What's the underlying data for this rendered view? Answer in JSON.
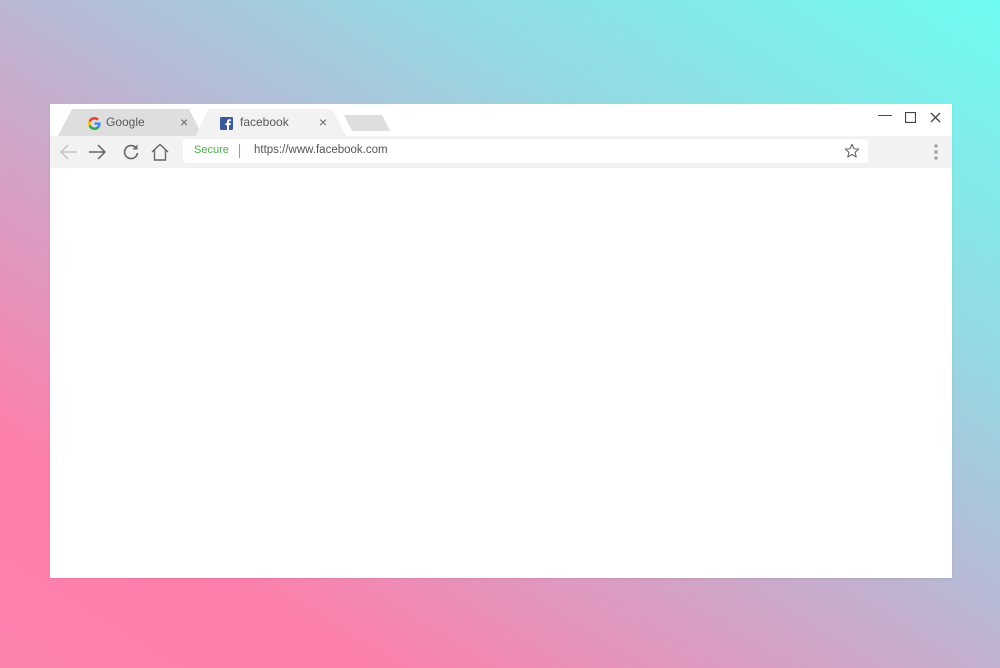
{
  "tabs": [
    {
      "title": "Google",
      "favicon": "google-g-icon",
      "active": false,
      "close_label": "×"
    },
    {
      "title": "facebook",
      "favicon": "facebook-f-icon",
      "active": true,
      "close_label": "×"
    }
  ],
  "window_controls": {
    "minimize": "—",
    "maximize": "☐",
    "close": "✕"
  },
  "toolbar": {
    "back_icon": "arrow-left-icon",
    "forward_icon": "arrow-right-icon",
    "reload_icon": "reload-icon",
    "home_icon": "home-icon",
    "menu_icon": "kebab-menu-icon",
    "bookmark_icon": "star-icon"
  },
  "omnibox": {
    "security_label": "Secure",
    "url": "https://www.facebook.com"
  },
  "colors": {
    "secure_green": "#4caf50",
    "facebook_blue": "#3b5998",
    "inactive_tab": "#dedede",
    "toolbar": "#f2f2f2",
    "gradient_start": "#6ffcf2",
    "gradient_end": "#fd82ac"
  }
}
